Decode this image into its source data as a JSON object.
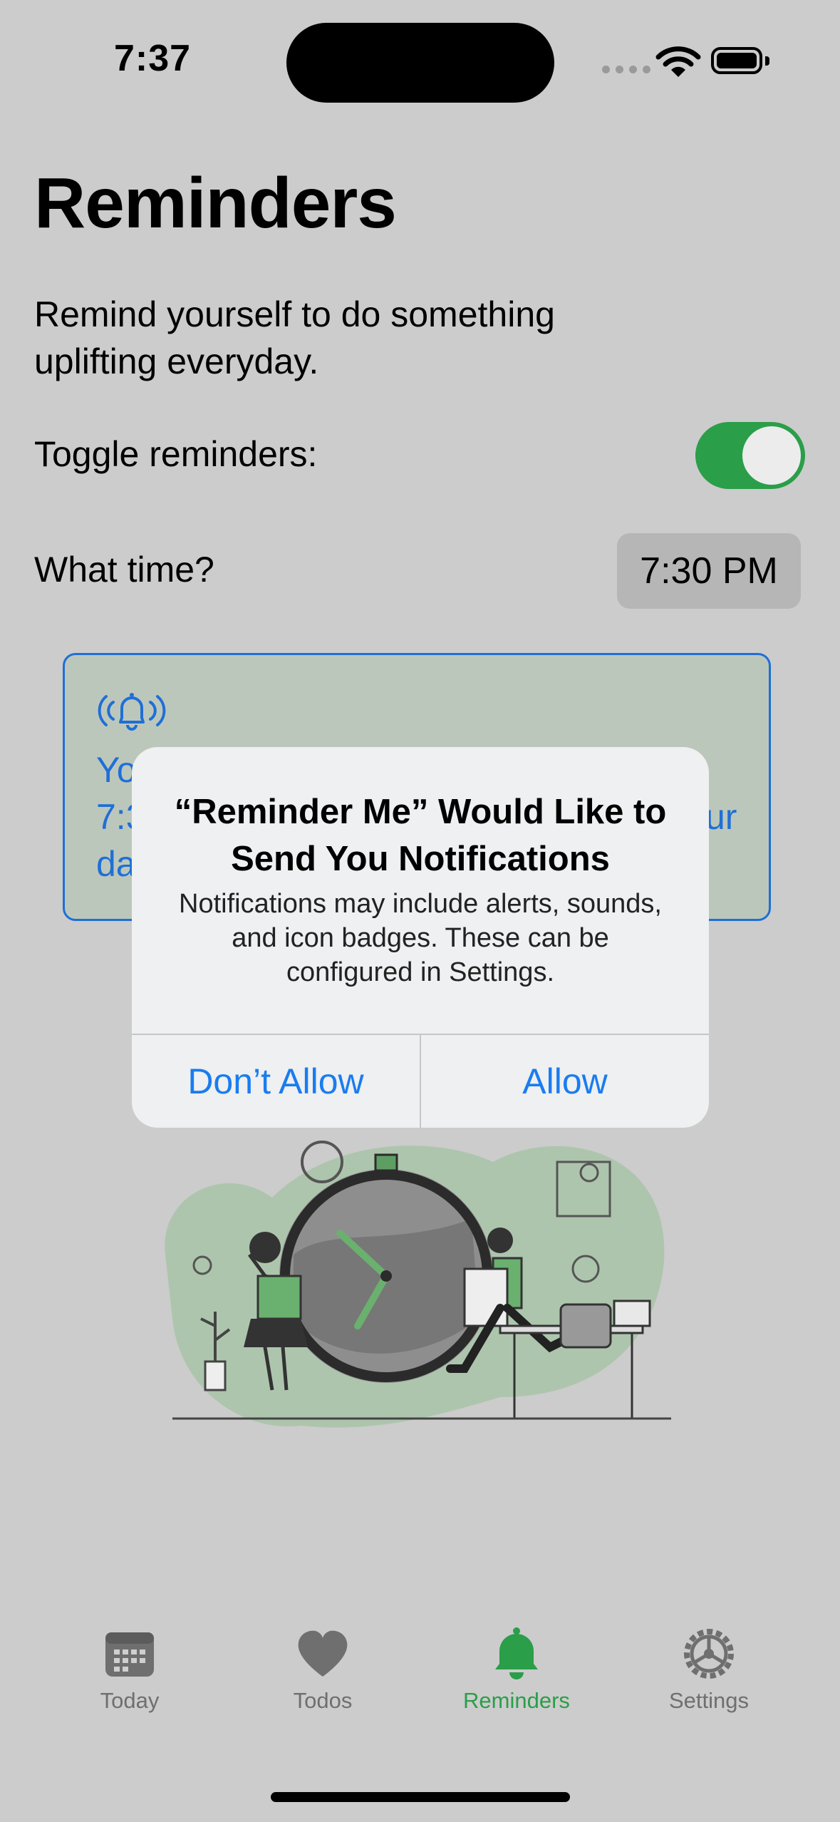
{
  "status_bar": {
    "time": "7:37"
  },
  "header": {
    "title": "Reminders"
  },
  "content": {
    "subtitle": "Remind yourself to do something uplifting everyday.",
    "toggle_label": "Toggle reminders:",
    "toggle_on": true,
    "time_label": "What time?",
    "time_value": "7:30 PM",
    "info_card": {
      "icon": "bell-ringing-icon",
      "message_fragments": [
        "Yo",
        "7:3",
        "ur",
        "da"
      ]
    }
  },
  "dialog": {
    "title": "“Reminder Me” Would Like to Send You Notifications",
    "message": "Notifications may include alerts, sounds, and icon badges. These can be configured in Settings.",
    "deny_label": "Don’t Allow",
    "allow_label": "Allow"
  },
  "tabbar": {
    "items": [
      {
        "label": "Today",
        "icon": "calendar-icon"
      },
      {
        "label": "Todos",
        "icon": "heart-icon"
      },
      {
        "label": "Reminders",
        "icon": "bell-icon",
        "active": true
      },
      {
        "label": "Settings",
        "icon": "gear-icon"
      }
    ]
  },
  "colors": {
    "accent_green": "#2a9e49",
    "link_blue": "#1a7cf0",
    "card_border": "#1f6fd6",
    "background": "#cccccc"
  }
}
